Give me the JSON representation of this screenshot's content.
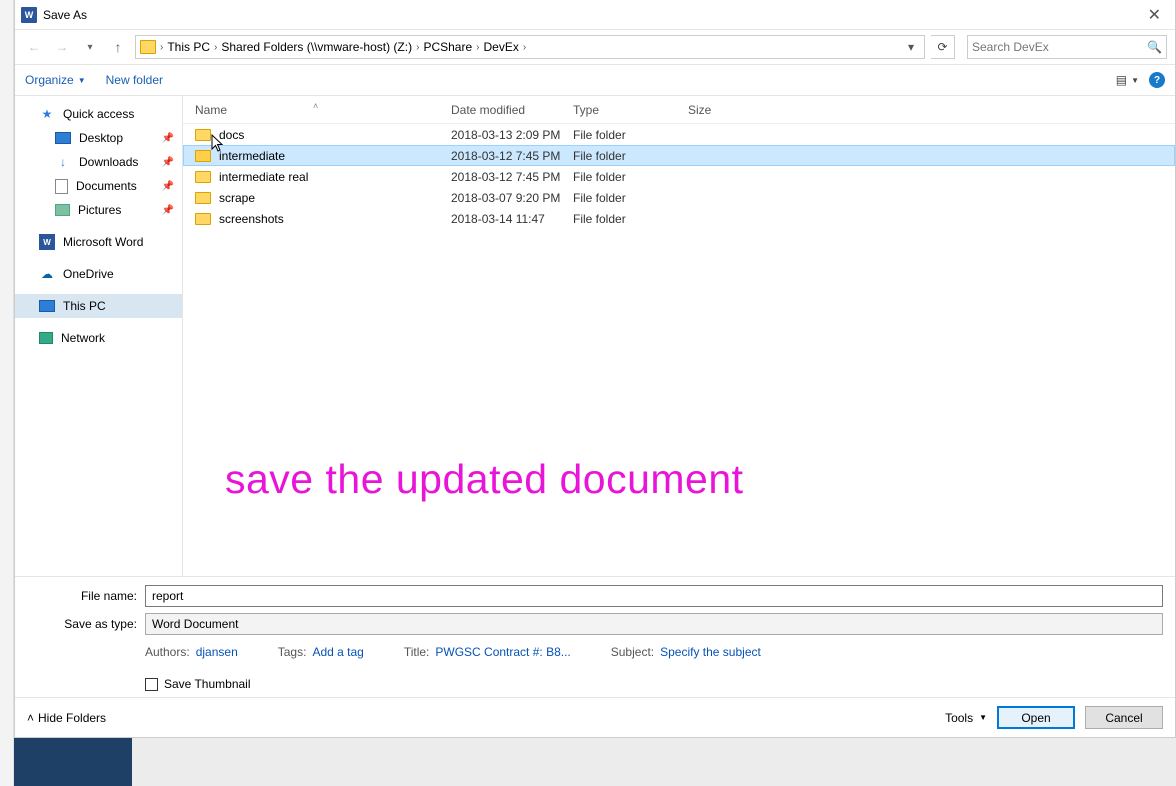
{
  "window": {
    "title": "Save As",
    "close_glyph": "✕"
  },
  "nav": {
    "back_glyph": "←",
    "fwd_glyph": "→",
    "recent_glyph": "▾",
    "up_glyph": "↑",
    "refresh_glyph": "⟳",
    "search_placeholder": "Search DevEx",
    "search_glyph": "🔍"
  },
  "breadcrumbs": [
    "This PC",
    "Shared Folders (\\\\vmware-host) (Z:)",
    "PCShare",
    "DevEx"
  ],
  "toolbar": {
    "organize": "Organize",
    "organize_chev": "▼",
    "new_folder": "New folder",
    "view_glyph": "▤",
    "view_chev": "▼",
    "help_glyph": "?"
  },
  "columns": {
    "name": "Name",
    "date": "Date modified",
    "type": "Type",
    "size": "Size",
    "sort_glyph": "˄"
  },
  "sidebar": {
    "quick": "Quick access",
    "desktop": "Desktop",
    "downloads": "Downloads",
    "documents": "Documents",
    "pictures": "Pictures",
    "word": "Microsoft Word",
    "onedrive": "OneDrive",
    "thispc": "This PC",
    "network": "Network",
    "pin_glyph": "📌"
  },
  "files": [
    {
      "name": "docs",
      "date": "2018-03-13 2:09 PM",
      "type": "File folder"
    },
    {
      "name": "intermediate",
      "date": "2018-03-12 7:45 PM",
      "type": "File folder"
    },
    {
      "name": "intermediate real",
      "date": "2018-03-12 7:45 PM",
      "type": "File folder"
    },
    {
      "name": "scrape",
      "date": "2018-03-07 9:20 PM",
      "type": "File folder"
    },
    {
      "name": "screenshots",
      "date": "2018-03-14 11:47",
      "type": "File folder"
    }
  ],
  "selected_row_index": 1,
  "annotation": "save the updated document",
  "form": {
    "filename_label": "File name:",
    "filename_value": "report",
    "type_label": "Save as type:",
    "type_value": "Word Document",
    "authors_label": "Authors:",
    "authors_value": "djansen",
    "tags_label": "Tags:",
    "tags_value": "Add a tag",
    "title_label": "Title:",
    "title_value": "PWGSC Contract #: B8...",
    "subject_label": "Subject:",
    "subject_value": "Specify the subject",
    "thumb_label": "Save Thumbnail"
  },
  "footer": {
    "hide_glyph": "˄",
    "hide_label": "Hide Folders",
    "tools_label": "Tools",
    "tools_chev": "▼",
    "primary": "Open",
    "cancel": "Cancel"
  }
}
